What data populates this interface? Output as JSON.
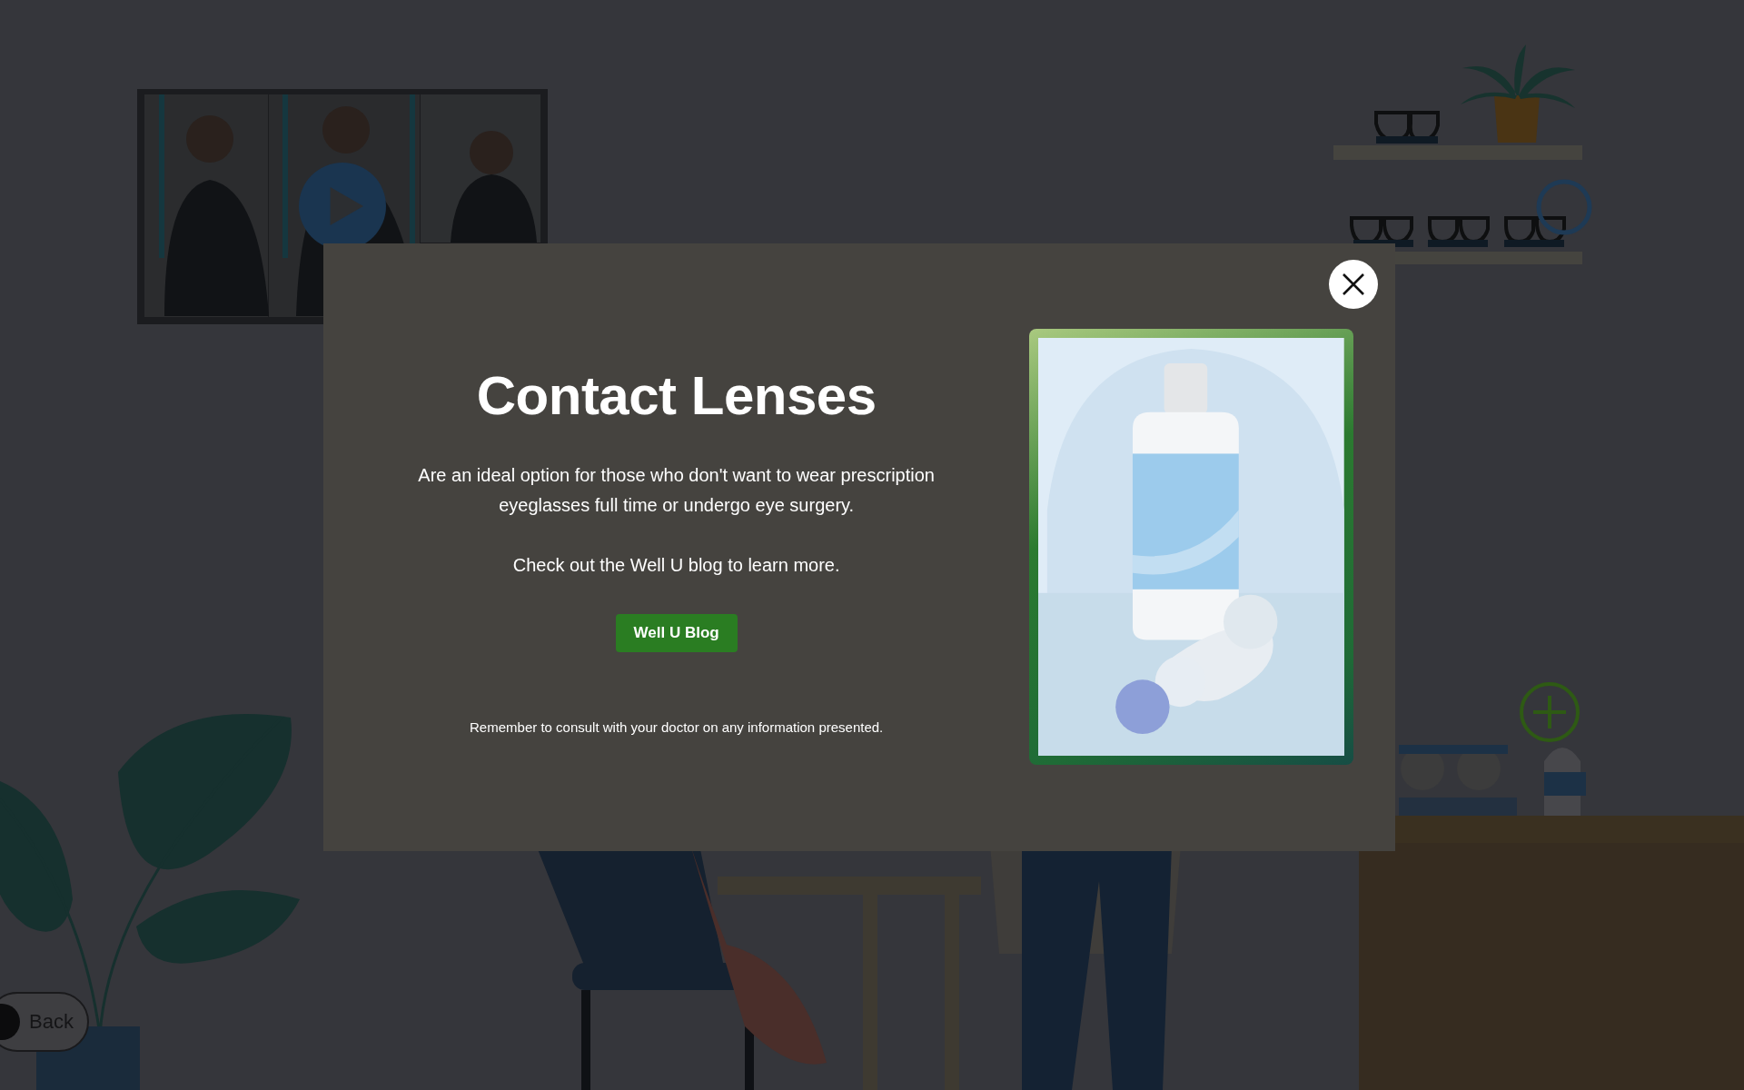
{
  "modal": {
    "title": "Contact Lenses",
    "paragraphs": [
      "Are an ideal option for those who don't want to wear prescription eyeglasses full time or undergo eye surgery.",
      "Check out the Well U blog to learn more."
    ],
    "button": "Well U Blog",
    "disclaimer": "Remember to consult with your doctor on any information presented."
  },
  "back_button": {
    "label": "Back"
  }
}
